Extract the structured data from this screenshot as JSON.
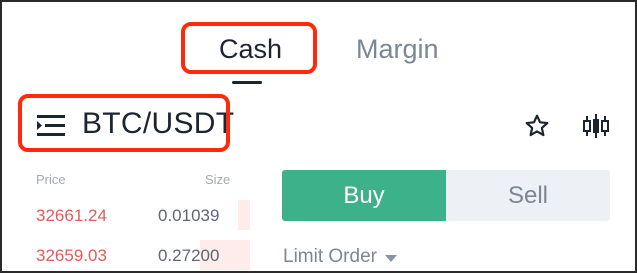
{
  "tabs": {
    "cash": "Cash",
    "margin": "Margin"
  },
  "pair": {
    "label": "BTC/USDT"
  },
  "icons": {
    "menu": "menu-lines-icon",
    "favorite": "star-icon",
    "chart": "candlestick-chart-icon"
  },
  "order_book": {
    "price_header": "Price",
    "size_header": "Size",
    "rows": [
      {
        "price": "32661.24",
        "size": "0.01039",
        "depth_fraction": 0.05
      },
      {
        "price": "32659.03",
        "size": "0.27200",
        "depth_fraction": 0.2
      }
    ]
  },
  "trade": {
    "buy_label": "Buy",
    "sell_label": "Sell",
    "order_type": "Limit Order"
  },
  "colors": {
    "highlight": "#ff2a0c",
    "buy": "#3db28a",
    "ask_price": "#e35b5b",
    "sell_bg": "#edf1f6"
  }
}
